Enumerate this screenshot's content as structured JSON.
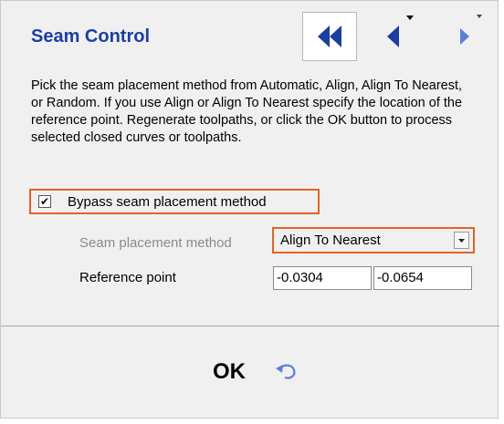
{
  "panel": {
    "title": "Seam Control",
    "description": "Pick the seam placement method from Automatic, Align, Align To Nearest, or Random. If you use Align or Align To Nearest specify the location of the reference point. Regenerate toolpaths, or click the OK button to process selected closed curves or toolpaths."
  },
  "nav": {
    "first_icon": "double-left-arrow-icon",
    "prev_icon": "left-arrow-icon",
    "next_icon": "right-arrow-icon"
  },
  "bypass": {
    "label": "Bypass seam placement method",
    "checked": true
  },
  "seam_method": {
    "label": "Seam placement method",
    "value": "Align To Nearest"
  },
  "reference_point": {
    "label": "Reference point",
    "x": "-0.0304",
    "y": "-0.0654"
  },
  "footer": {
    "ok_label": "OK",
    "undo_icon": "undo-icon"
  },
  "colors": {
    "title": "#1a3fa0",
    "highlight": "#e0642b",
    "arrow": "#1a3fa0"
  }
}
